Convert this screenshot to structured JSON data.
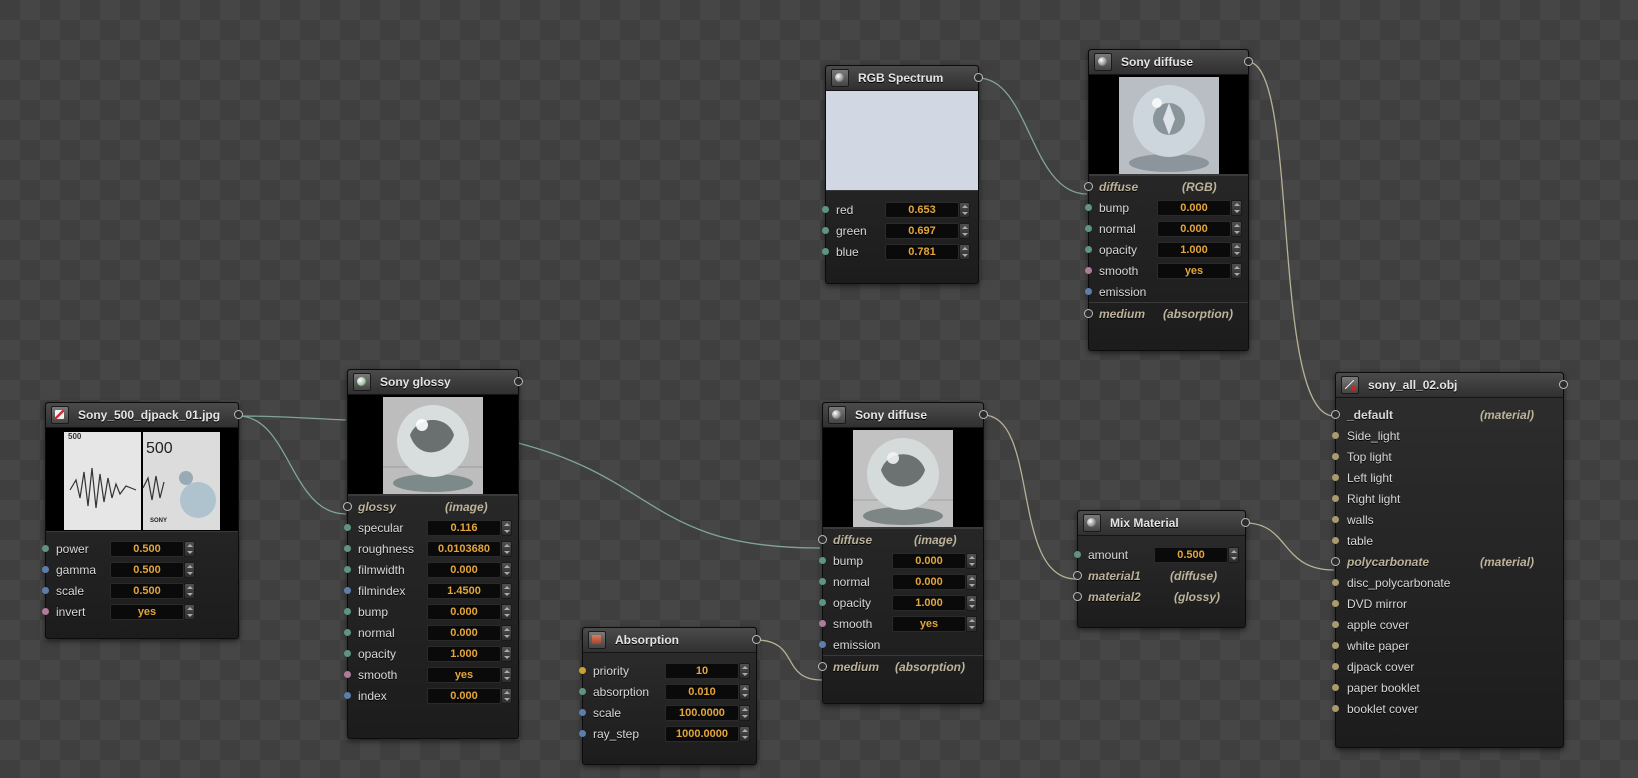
{
  "colors": {
    "spectrum_swatch": "#d2d8e3",
    "value_text": "#e3a53c",
    "link_text": "#bdb39a",
    "wire": "#7fa59a",
    "wire_material": "#b7b195"
  },
  "nodes": {
    "texture": {
      "title": "Sony_500_djpack_01.jpg",
      "icon": "texture-icon",
      "preview_text": {
        "left_num": "500",
        "right_num": "500",
        "brand": "SONY"
      },
      "params": [
        {
          "label": "power",
          "value": "0.500"
        },
        {
          "label": "gamma",
          "value": "0.500"
        },
        {
          "label": "scale",
          "value": "0.500"
        },
        {
          "label": "invert",
          "value": "yes"
        }
      ]
    },
    "glossy": {
      "title": "Sony glossy",
      "icon": "glossy-sphere-icon",
      "link": {
        "label": "glossy",
        "tag": "(image)"
      },
      "params": [
        {
          "label": "specular",
          "value": "0.116"
        },
        {
          "label": "roughness",
          "value": "0.0103680"
        },
        {
          "label": "filmwidth",
          "value": "0.000"
        },
        {
          "label": "filmindex",
          "value": "1.4500"
        },
        {
          "label": "bump",
          "value": "0.000"
        },
        {
          "label": "normal",
          "value": "0.000"
        },
        {
          "label": "opacity",
          "value": "1.000"
        },
        {
          "label": "smooth",
          "value": "yes"
        },
        {
          "label": "index",
          "value": "0.000"
        }
      ]
    },
    "rgb": {
      "title": "RGB Spectrum",
      "icon": "sphere-icon",
      "params": [
        {
          "label": "red",
          "value": "0.653"
        },
        {
          "label": "green",
          "value": "0.697"
        },
        {
          "label": "blue",
          "value": "0.781"
        }
      ]
    },
    "diffuse_top": {
      "title": "Sony diffuse",
      "icon": "sphere-icon",
      "link": {
        "label": "diffuse",
        "tag": "(RGB)"
      },
      "params": [
        {
          "label": "bump",
          "value": "0.000"
        },
        {
          "label": "normal",
          "value": "0.000"
        },
        {
          "label": "opacity",
          "value": "1.000"
        },
        {
          "label": "smooth",
          "value": "yes"
        }
      ],
      "emission": "emission",
      "medium": {
        "label": "medium",
        "tag": "(absorption)"
      }
    },
    "diffuse_mid": {
      "title": "Sony diffuse",
      "icon": "sphere-icon",
      "link": {
        "label": "diffuse",
        "tag": "(image)"
      },
      "params": [
        {
          "label": "bump",
          "value": "0.000"
        },
        {
          "label": "normal",
          "value": "0.000"
        },
        {
          "label": "opacity",
          "value": "1.000"
        },
        {
          "label": "smooth",
          "value": "yes"
        }
      ],
      "emission": "emission",
      "medium": {
        "label": "medium",
        "tag": "(absorption)"
      }
    },
    "absorption": {
      "title": "Absorption",
      "icon": "absorption-icon",
      "params": [
        {
          "label": "priority",
          "value": "10"
        },
        {
          "label": "absorption",
          "value": "0.010"
        },
        {
          "label": "scale",
          "value": "100.0000"
        },
        {
          "label": "ray_step",
          "value": "1000.0000"
        }
      ]
    },
    "mix": {
      "title": "Mix Material",
      "icon": "sphere-icon",
      "amount": {
        "label": "amount",
        "value": "0.500"
      },
      "material1": {
        "label": "material1",
        "tag": "(diffuse)"
      },
      "material2": {
        "label": "material2",
        "tag": "(glossy)"
      }
    },
    "mesh": {
      "title": "sony_all_02.obj",
      "icon": "mesh-icon",
      "default": {
        "label": "_default",
        "tag": "(material)"
      },
      "polycarbonate": {
        "label": "polycarbonate",
        "tag": "(material)"
      },
      "items": [
        "Side_light",
        "Top light",
        "Left light",
        "Right light",
        "walls",
        "table"
      ],
      "items2": [
        "disc_polycarbonate",
        "DVD mirror",
        "apple cover",
        "white paper",
        "djpack cover",
        "paper booklet",
        "booklet cover"
      ]
    }
  }
}
